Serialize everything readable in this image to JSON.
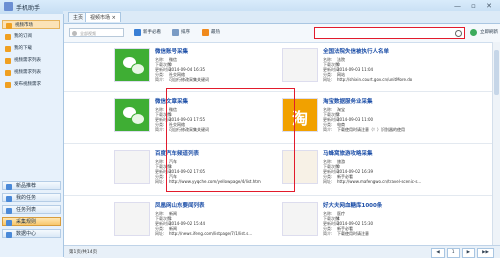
{
  "titlebar": {
    "title": "手机助手",
    "window_controls": "— ▫ ✕"
  },
  "tabs": [
    {
      "label": "主页"
    },
    {
      "label": "视频市场 ×"
    }
  ],
  "sidebar": {
    "items": [
      {
        "label": "视频市场"
      },
      {
        "label": "我的订阅"
      },
      {
        "label": "我的下载"
      },
      {
        "label": "视频需求列表"
      },
      {
        "label": "视频需求列表"
      },
      {
        "label": "发布视频需求"
      }
    ],
    "bottom_items": [
      {
        "label": "新品推荐"
      },
      {
        "label": "我的任务"
      },
      {
        "label": "任务列表"
      },
      {
        "label": "采集规则"
      },
      {
        "label": "数据中心"
      }
    ]
  },
  "toolbar": {
    "filter_placeholder": "全部视频",
    "new_btn": "新手必看",
    "sort_btn": "排序",
    "hot_btn": "最热",
    "search_placeholder": "",
    "refresh_btn": "立即刷新"
  },
  "cards": [
    {
      "title": "微信账号采集",
      "rows": [
        [
          "名称:",
          "微信"
        ],
        [
          "下载次数:",
          "0"
        ],
        [
          "更新时间:",
          "2014-09-04 16:35"
        ],
        [
          "分类:",
          "社交网络"
        ],
        [
          "简介:",
          "可自行修改采集关键词"
        ]
      ]
    },
    {
      "title": "全国法院失信被执行人名单",
      "rows": [
        [
          "名称:",
          "法院"
        ],
        [
          "下载次数:",
          "0"
        ],
        [
          "更新时间:",
          "2014-09-03 11:04"
        ],
        [
          "分类:",
          "网站"
        ],
        [
          "网址:",
          "http://shixin.court.gov.cn/unitMore.do"
        ]
      ]
    },
    {
      "title": "微信文章采集",
      "rows": [
        [
          "名称:",
          "微信"
        ],
        [
          "下载次数:",
          "5"
        ],
        [
          "更新时间:",
          "2014-09-03 17:55"
        ],
        [
          "分类:",
          "社交网络"
        ],
        [
          "简介:",
          "可自行修改采集关键词"
        ]
      ]
    },
    {
      "title": "淘宝数据服务业采集",
      "rows": [
        [
          "名称:",
          "淘宝"
        ],
        [
          "下载次数:",
          "2"
        ],
        [
          "更新时间:",
          "2014-09-03 11:00"
        ],
        [
          "分类:",
          "电商"
        ],
        [
          "简介:",
          "下载使用时请注意（！）识别器的使用"
        ]
      ]
    },
    {
      "title": "百度汽车频道列表",
      "rows": [
        [
          "名称:",
          "汽车"
        ],
        [
          "下载次数:",
          "3"
        ],
        [
          "更新时间:",
          "2014-09-02 17:05"
        ],
        [
          "分类:",
          "汽车"
        ],
        [
          "网址:",
          "http://www.yyqche.com/yellowpage/4/list.htm"
        ]
      ]
    },
    {
      "title": "马蜂窝旅游攻略采集",
      "rows": [
        [
          "名称:",
          "旅游"
        ],
        [
          "下载次数:",
          "0"
        ],
        [
          "更新时间:",
          "2014-09-02 16:39"
        ],
        [
          "分类:",
          "新手必看"
        ],
        [
          "网址:",
          "http://www.mafengwo.cn/travel-scenic-s..."
        ]
      ]
    },
    {
      "title": "凤凰网山东要闻列表",
      "rows": [
        [
          "名称:",
          "新闻"
        ],
        [
          "下载次数:",
          "1"
        ],
        [
          "更新时间:",
          "2014-09-02 15:44"
        ],
        [
          "分类:",
          "新闻"
        ],
        [
          "网址:",
          "http://news.ifeng.com/listpage/7/1/list.s..."
        ]
      ]
    },
    {
      "title": "好大夫网血糖库1000条",
      "rows": [
        [
          "名称:",
          "医疗"
        ],
        [
          "下载次数:",
          "4"
        ],
        [
          "更新时间:",
          "2014-09-02 15:30"
        ],
        [
          "分类:",
          "新手必看"
        ],
        [
          "简介:",
          "下载使用时请注意"
        ]
      ]
    }
  ],
  "statusbar": {
    "text": "第1页/共14页",
    "pager": [
      "◀",
      "1",
      "▶",
      "▶▶"
    ]
  },
  "colors": {
    "highlight": "#e21b2c",
    "sidebar_selected": "#f8c76c",
    "title_link": "#1d4fa8"
  }
}
